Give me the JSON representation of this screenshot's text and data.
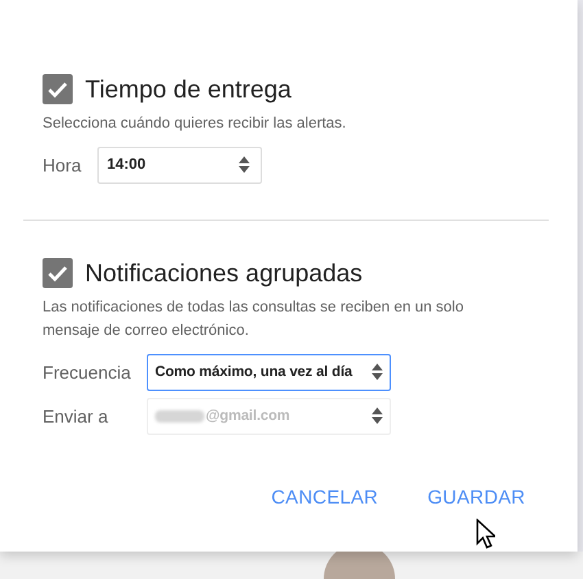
{
  "sections": [
    {
      "title": "Tiempo de entrega",
      "checked": true,
      "description": "Selecciona cuándo quieres recibir las alertas.",
      "fields": [
        {
          "label": "Hora",
          "value": "14:00",
          "focused": false,
          "disabled": false,
          "redacted": false
        }
      ]
    },
    {
      "title": "Notificaciones agrupadas",
      "checked": true,
      "description": "Las notificaciones de todas las consultas se reciben en un solo mensaje de correo electrónico.",
      "fields": [
        {
          "label": "Frecuencia",
          "value": "Como máximo, una vez al día",
          "focused": true,
          "disabled": false,
          "redacted": false
        },
        {
          "label": "Enviar a",
          "value": "@gmail.com",
          "focused": false,
          "disabled": true,
          "redacted": true
        }
      ]
    }
  ],
  "buttons": [
    "CANCELAR",
    "GUARDAR"
  ]
}
